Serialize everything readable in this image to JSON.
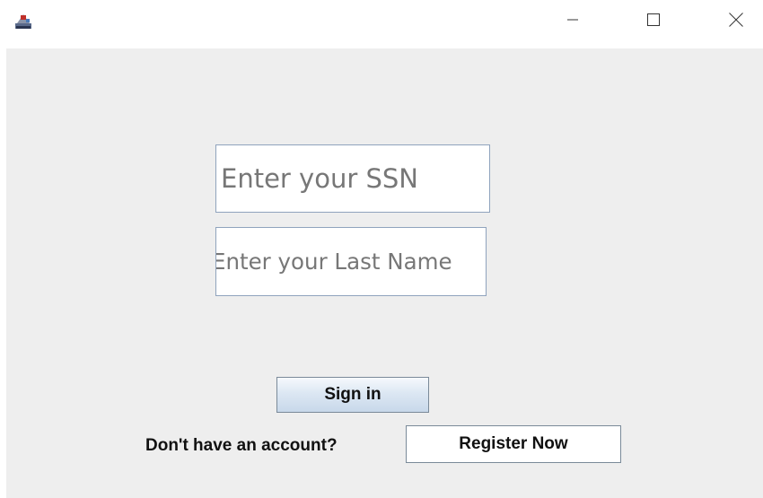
{
  "titlebar": {
    "app_icon": "java-app-icon",
    "controls": {
      "minimize_icon": "minimize-icon",
      "maximize_icon": "maximize-icon",
      "close_icon": "close-icon"
    }
  },
  "form": {
    "ssn_field": {
      "value": "Enter your SSN",
      "placeholder": ""
    },
    "last_name_field": {
      "value": "Enter your Last Name",
      "placeholder": ""
    },
    "sign_in_label": "Sign in",
    "no_account_prompt": "Don't have an account?",
    "register_label": "Register Now"
  },
  "colors": {
    "panel_background": "#eeeeee",
    "field_border": "#8fa3bd",
    "field_text": "#777777"
  }
}
